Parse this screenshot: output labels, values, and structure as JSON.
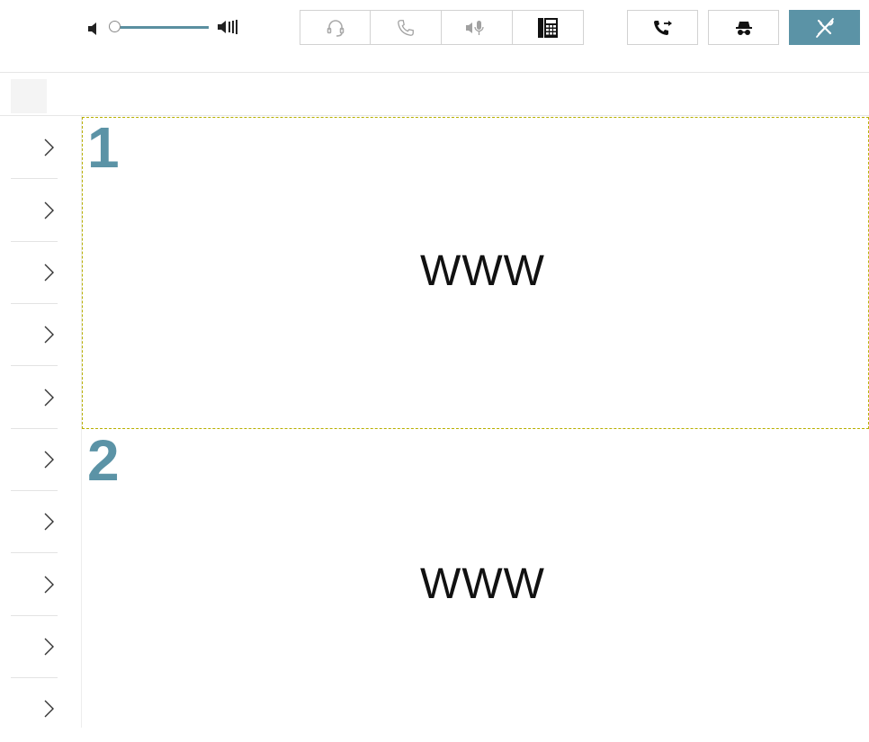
{
  "toolbar": {
    "volume": {
      "level": 0.0
    },
    "phone_buttons": [
      {
        "name": "headset-button",
        "icon": "headset-icon",
        "enabled": false
      },
      {
        "name": "phone-button",
        "icon": "phone-icon",
        "enabled": false
      },
      {
        "name": "mute-mic-button",
        "icon": "mute-microphone-icon",
        "enabled": false
      },
      {
        "name": "dialpad-button",
        "icon": "dialpad-icon",
        "enabled": true
      }
    ],
    "right_buttons": [
      {
        "name": "transfer-call-button",
        "icon": "call-transfer-icon"
      },
      {
        "name": "incognito-button",
        "icon": "incognito-icon"
      },
      {
        "name": "tools-button",
        "icon": "tools-crossed-icon",
        "active": true
      }
    ]
  },
  "sidebar": {
    "rows": 10,
    "icon": "chevron-right-icon"
  },
  "slots": [
    {
      "number": "1",
      "text": "WWW"
    },
    {
      "number": "2",
      "text": "WWW"
    }
  ],
  "colors": {
    "accent": "#5b93a6",
    "focus_outline": "#b8b000"
  }
}
